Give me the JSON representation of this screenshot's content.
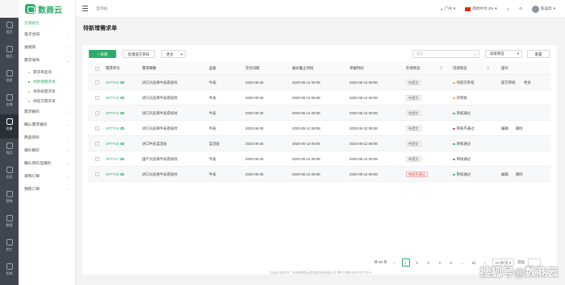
{
  "rail": {
    "items": [
      {
        "label": "首页"
      },
      {
        "label": "商品"
      },
      {
        "label": "资质"
      },
      {
        "label": "店铺"
      },
      {
        "label": "交易"
      },
      {
        "label": "商品"
      },
      {
        "label": "会员"
      },
      {
        "label": "营销"
      },
      {
        "label": "数据"
      },
      {
        "label": "加工"
      },
      {
        "label": "系统"
      }
    ]
  },
  "brand": {
    "name": "数商云"
  },
  "sidenav": {
    "section": "交易助力",
    "items": [
      {
        "label": "电子合同"
      },
      {
        "label": "进销存"
      },
      {
        "label": "需求发布"
      },
      {
        "label": "需求报价"
      },
      {
        "label": "确认需求报价"
      },
      {
        "label": "商品询价"
      },
      {
        "label": "报价报价"
      },
      {
        "label": "确认询价品报价"
      },
      {
        "label": "采购订单"
      },
      {
        "label": "销售订单"
      }
    ],
    "subitems": [
      {
        "label": "需求单查询"
      },
      {
        "label": "待新增需求单"
      },
      {
        "label": "待审核需求单"
      },
      {
        "label": "待提交需求单"
      }
    ]
  },
  "topbar": {
    "breadcrumb": "官内站",
    "location": "广州",
    "language": "简体中文-ZH",
    "username": "陈美欣"
  },
  "page": {
    "title": "待新增需求单"
  },
  "toolbar": {
    "new_label": "+ 新建",
    "batch_label": "批量提交审核",
    "more_label": "更多",
    "search_placeholder": "搜索",
    "advanced_label": "高级筛选",
    "reset_label": "重置"
  },
  "table": {
    "headers": [
      "需求单号",
      "需求摘要",
      "品类",
      "交付日期",
      "报价截止时间",
      "单据时间",
      "外部状态",
      "内部状态",
      "操作"
    ],
    "rows": [
      {
        "id": "SPTY13",
        "summary": "进口头层黄牛皮荔枝纹",
        "category": "牛皮",
        "delivery": "2020-08-25",
        "deadline": "2020-05-12 08:08",
        "created": "2020-05-12 08:08",
        "external": "待提交",
        "internal": "待提交审核",
        "internal_color": "#f5a623",
        "actions": [
          "提交审核",
          "更多"
        ]
      },
      {
        "id": "SPTY13",
        "summary": "进口头层黄牛皮荔枝纹",
        "category": "牛皮",
        "delivery": "2020-08-25",
        "deadline": "2020-05-12 08:08",
        "created": "2020-05-12 08:08",
        "external": "待提交",
        "internal": "待审核",
        "internal_color": "#f5a623",
        "actions": []
      },
      {
        "id": "SPTY14",
        "summary": "进口头层黄牛皮荔枝纹",
        "category": "牛皮",
        "delivery": "2020-08-25",
        "deadline": "2020-05-12 08:08",
        "created": "2020-05-12 08:08",
        "external": "待提交",
        "internal": "审核通过",
        "internal_color": "#2ead6a",
        "actions": []
      },
      {
        "id": "SPTY15",
        "summary": "进口头层黄牛皮荔枝纹",
        "category": "牛皮",
        "delivery": "2020-08-25",
        "deadline": "2020-05-12 08:08",
        "created": "2020-05-12 08:08",
        "external": "待提交",
        "internal": "审核不通过",
        "internal_color": "#e64545",
        "actions": [
          "编辑",
          "删除"
        ]
      },
      {
        "id": "SPTY16",
        "summary": "进口牛皮蓝湿皮",
        "category": "蓝湿皮",
        "delivery": "2020-08-25",
        "deadline": "2020-05-12 08:08",
        "created": "2020-05-12 08:08",
        "external": "待提交",
        "internal": "审核通过",
        "internal_color": "#2ead6a",
        "actions": []
      },
      {
        "id": "SPTY17",
        "summary": "国产头层黄牛皮荔枝纹",
        "category": "牛皮",
        "delivery": "2020-08-25",
        "deadline": "2020-05-12 08:08",
        "created": "2020-05-12 08:08",
        "external": "待提交",
        "internal": "审核通过",
        "internal_color": "#2ead6a",
        "actions": []
      },
      {
        "id": "SPTY18",
        "summary": "进口头层黄牛皮荔枝纹",
        "category": "牛皮",
        "delivery": "2020-08-25",
        "deadline": "2020-05-12 08:08",
        "created": "2020-05-12 08:08",
        "external": "审核不通过",
        "external_red": true,
        "internal": "审核通过",
        "internal_color": "#2ead6a",
        "actions": [
          "编辑",
          "删除"
        ]
      }
    ]
  },
  "pagination": {
    "total": "共 80 条",
    "pages": [
      "1",
      "2",
      "3",
      "4",
      "5",
      "...",
      "10"
    ],
    "current": "1",
    "page_size": "10 条/页",
    "goto_label": "前往"
  },
  "footer": "Copy Right©广州市数商云网络科技有限公司 粤ICP备13044787号-5",
  "watermark": "搜狐号@数商云",
  "colors": {
    "accent": "#2ead6a",
    "danger": "#e64545",
    "warning": "#f5a623",
    "rail": "#3f464f"
  }
}
